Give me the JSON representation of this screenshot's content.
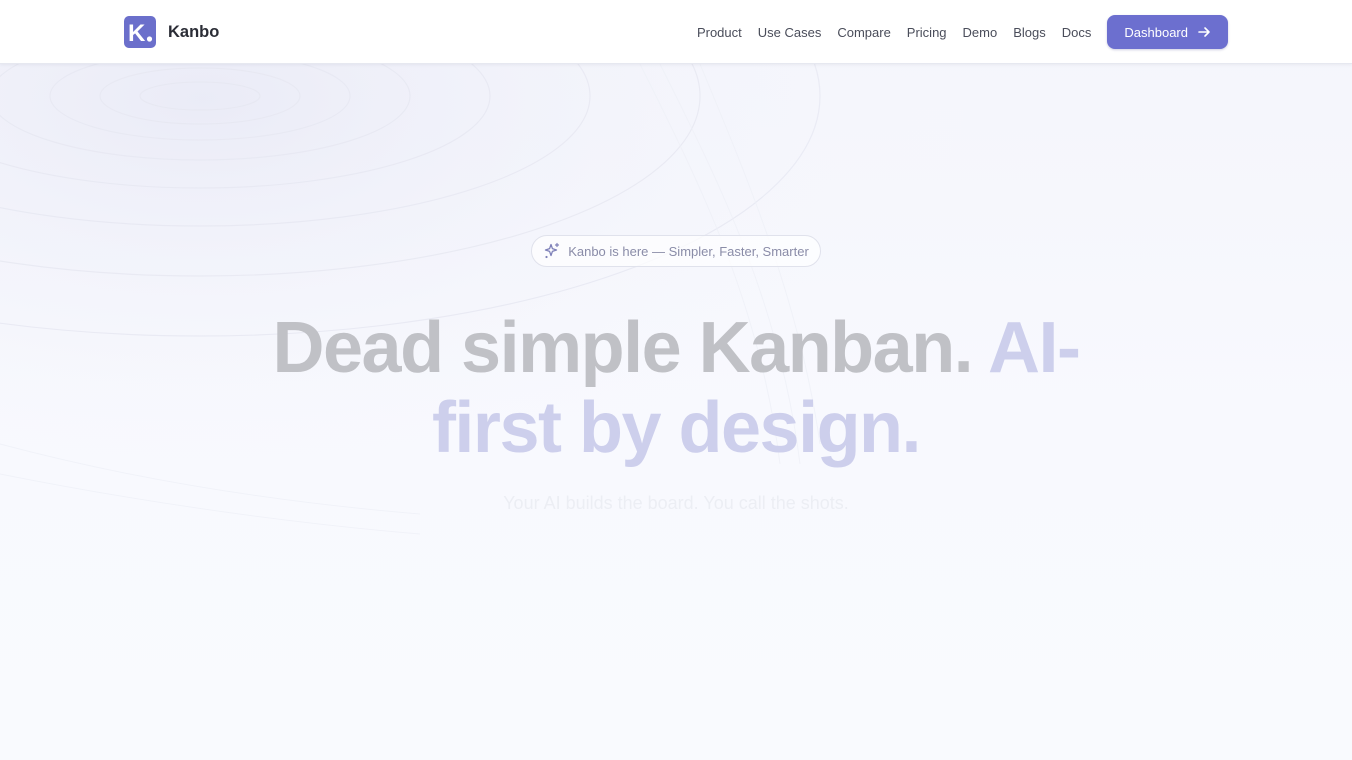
{
  "brand": {
    "name": "Kanbo",
    "logo_letter": "K"
  },
  "nav": {
    "items": [
      "Product",
      "Use Cases",
      "Compare",
      "Pricing",
      "Demo",
      "Blogs",
      "Docs"
    ],
    "cta_label": "Dashboard"
  },
  "hero": {
    "badge": "Kanbo is here — Simpler, Faster, Smarter",
    "headline_plain": "Dead simple Kanban.",
    "headline_accent": "AI-first by design.",
    "subheadline": "Your AI builds the board. You call the shots."
  },
  "colors": {
    "accent": "#6c6fcf",
    "headline_grey": "#c0c1c6",
    "headline_accent": "#cdcfec"
  },
  "icons": {
    "logo": "kanbo-logo-icon",
    "cta": "arrow-right-icon",
    "badge": "sparkles-icon"
  }
}
